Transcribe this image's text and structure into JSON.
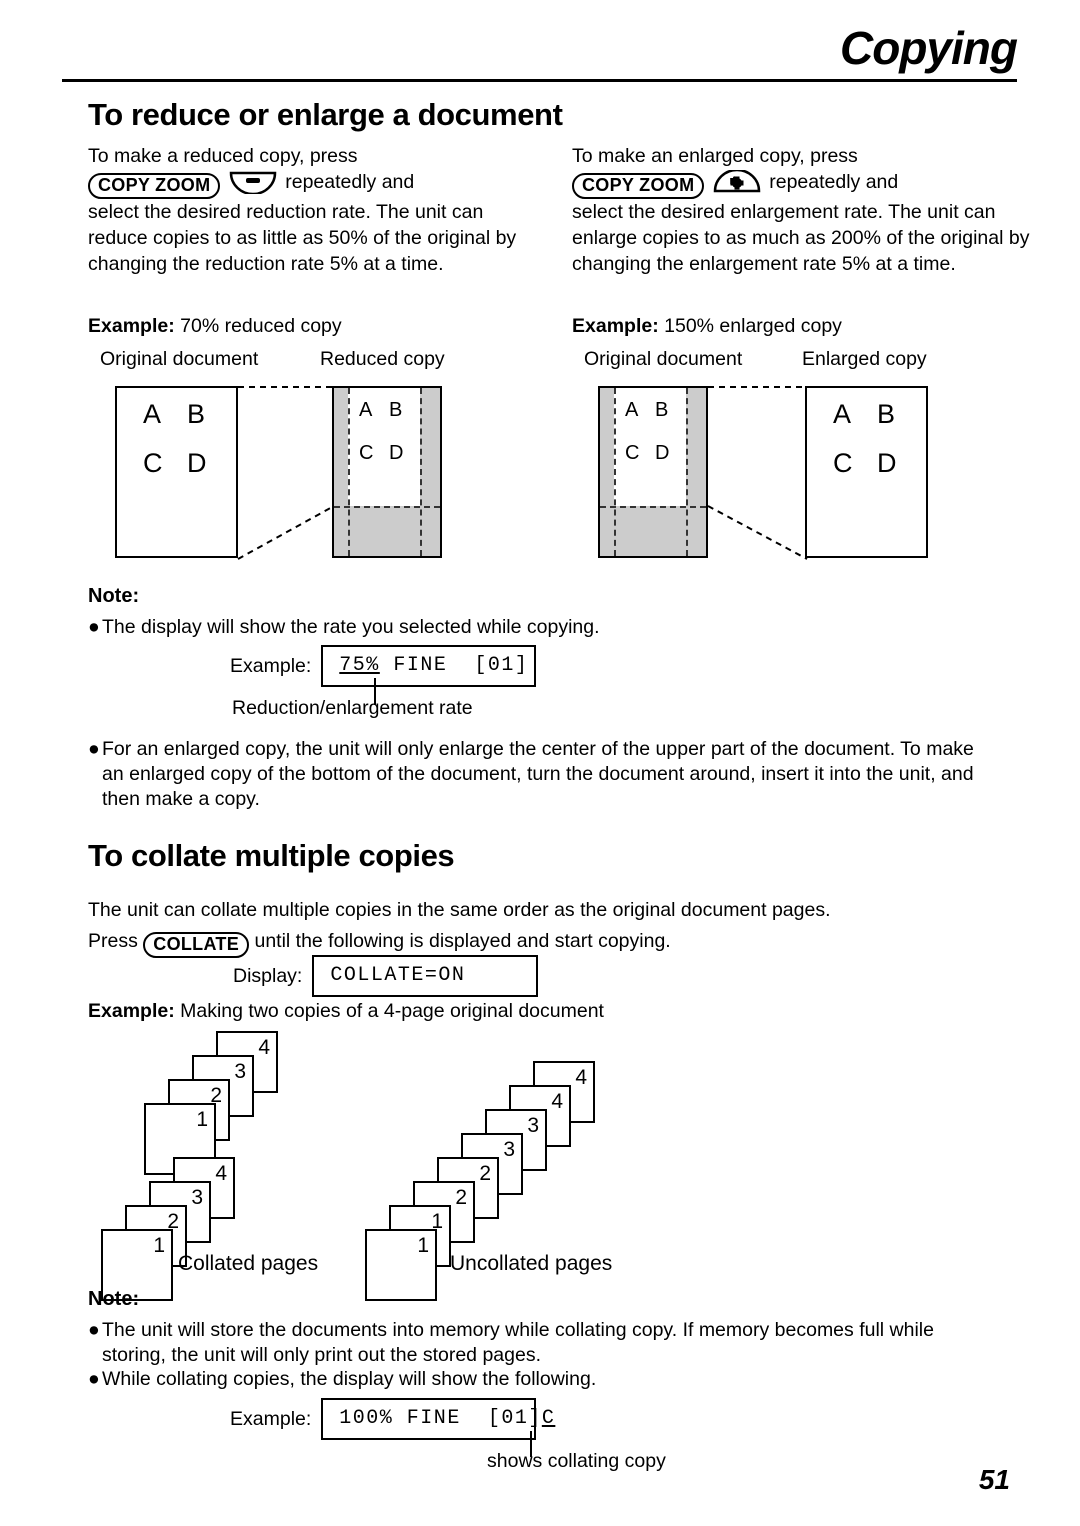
{
  "header": {
    "chapter_title": "Copying"
  },
  "page_number": "51",
  "section_reduce": {
    "heading": "To reduce or enlarge a document",
    "left": {
      "line1": "To make a reduced copy, press",
      "button_label": "COPY ZOOM",
      "icon": "minus-rocker-icon",
      "line2_after_icon": "repeatedly and",
      "body": "select the desired reduction rate. The unit can reduce copies to as little as 50% of the original by changing the reduction rate 5% at a time.",
      "example_label": "Example:",
      "example_text": "70% reduced copy",
      "caption_original": "Original document",
      "caption_result": "Reduced copy",
      "page_glyphs": [
        "A",
        "B",
        "C",
        "D"
      ]
    },
    "right": {
      "line1": "To make an enlarged copy, press",
      "button_label": "COPY ZOOM",
      "icon": "plus-rocker-icon",
      "line2_after_icon": "repeatedly and",
      "body": "select the desired enlargement rate. The unit can enlarge copies to as much as 200% of the original by changing the enlargement rate 5% at a time.",
      "example_label": "Example:",
      "example_text": "150% enlarged copy",
      "caption_original": "Original document",
      "caption_result": "Enlarged copy",
      "page_glyphs": [
        "A",
        "B",
        "C",
        "D"
      ]
    },
    "note": {
      "heading": "Note:",
      "bullet1": "The display will show the rate you selected while copying.",
      "example_label": "Example:",
      "display_underlined": "75%",
      "display_rest": " FINE  [01]",
      "callout": "Reduction/enlargement rate",
      "bullet2": "For an enlarged copy, the unit will only enlarge the center of the upper part of the document. To make an enlarged copy of the bottom of the document, turn the document around, insert it into the unit, and then make a copy."
    }
  },
  "section_collate": {
    "heading": "To collate multiple copies",
    "intro_line1": "The unit can collate multiple copies in the same order as the original document pages.",
    "intro_press": "Press",
    "button_label": "COLLATE",
    "intro_line2_after_button": "until the following is displayed and start copying.",
    "display_label": "Display:",
    "display_value": "COLLATE=ON",
    "example_label": "Example:",
    "example_text": "Making two copies of a 4-page original document",
    "collated_caption": "Collated pages",
    "uncollated_caption": "Uncollated pages",
    "collated_stack_top": [
      "1",
      "2",
      "3",
      "4"
    ],
    "collated_stack_bottom": [
      "1",
      "2",
      "3",
      "4"
    ],
    "uncollated_stack": [
      "1",
      "1",
      "2",
      "2",
      "3",
      "3",
      "4",
      "4"
    ],
    "note": {
      "heading": "Note:",
      "bullet1": "The unit will store the documents into memory while collating copy. If memory becomes full while storing, the unit will only print out the stored pages.",
      "bullet2": "While collating copies, the display will show the following.",
      "example_label": "Example:",
      "display_prefix": "100% FINE  [01]",
      "display_underlined": "C",
      "callout": "shows collating copy"
    }
  },
  "colors": {
    "page_gray": "#cccccc",
    "ink": "#000000"
  }
}
